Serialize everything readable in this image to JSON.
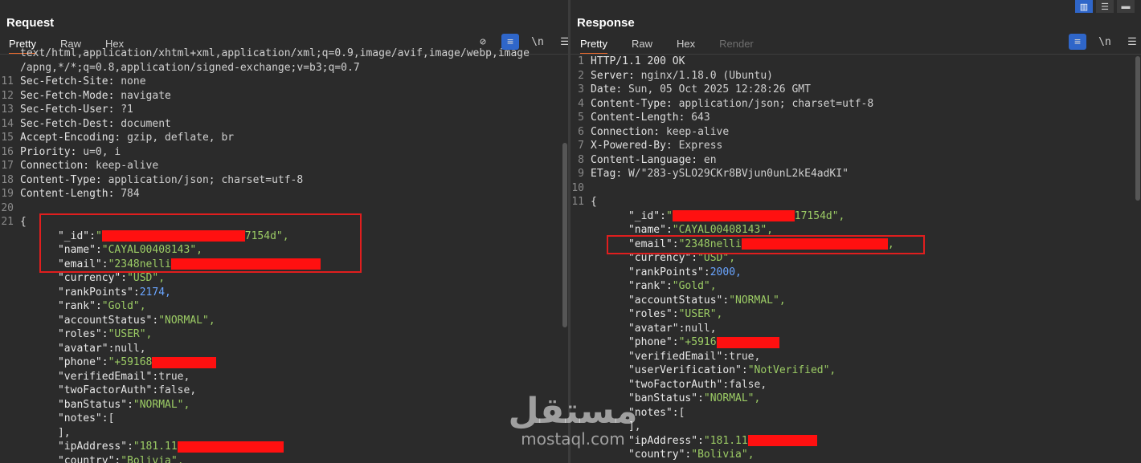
{
  "request": {
    "title": "Request",
    "tabs": [
      "Pretty",
      "Raw",
      "Hex"
    ],
    "tools": {
      "hide": "⊘",
      "wrap": "≡",
      "newline": "\\n",
      "menu": "☰"
    },
    "overflow_line": "text/html,application/xhtml+xml,application/xml;q=0.9,image/avif,image/webp,image",
    "line9_text": "/apng,*/*;q=0.8,application/signed-exchange;v=b3;q=0.7",
    "headers": [
      {
        "num": "11",
        "key": "Sec-Fetch-Site",
        "val": "none"
      },
      {
        "num": "12",
        "key": "Sec-Fetch-Mode",
        "val": "navigate"
      },
      {
        "num": "13",
        "key": "Sec-Fetch-User",
        "val": "?1"
      },
      {
        "num": "14",
        "key": "Sec-Fetch-Dest",
        "val": "document"
      },
      {
        "num": "15",
        "key": "Accept-Encoding",
        "val": "gzip, deflate, br"
      },
      {
        "num": "16",
        "key": "Priority",
        "val": "u=0, i"
      },
      {
        "num": "17",
        "key": "Connection",
        "val": "keep-alive"
      },
      {
        "num": "18",
        "key": "Content-Type",
        "val": "application/json; charset=utf-8"
      },
      {
        "num": "19",
        "key": "Content-Length",
        "val": "784"
      }
    ],
    "blank_num": "20",
    "brace_num": "21",
    "json_lines": [
      {
        "key": "\"_id\"",
        "val": "\"",
        "tail": "7154d\",",
        "type": "s",
        "redact": 178
      },
      {
        "key": "\"name\"",
        "val": "\"CAYAL00408143\",",
        "type": "s"
      },
      {
        "key": "\"email\"",
        "val": "\"2348nelli",
        "tail": "",
        "type": "s",
        "redact": 186
      },
      {
        "key": "\"currency\"",
        "val": "\"USD\",",
        "type": "s"
      },
      {
        "key": "\"rankPoints\"",
        "val": "2174,",
        "type": "n"
      },
      {
        "key": "\"rank\"",
        "val": "\"Gold\",",
        "type": "s"
      },
      {
        "key": "\"accountStatus\"",
        "val": "\"NORMAL\",",
        "type": "s"
      },
      {
        "key": "\"roles\"",
        "val": "\"USER\",",
        "type": "s"
      },
      {
        "key": "\"avatar\"",
        "val": "null,",
        "type": "b"
      },
      {
        "key": "\"phone\"",
        "val": "\"+59168",
        "tail": "",
        "type": "s",
        "redact": 80
      },
      {
        "key": "\"verifiedEmail\"",
        "val": "true,",
        "type": "b"
      },
      {
        "key": "\"twoFactorAuth\"",
        "val": "false,",
        "type": "b"
      },
      {
        "key": "\"banStatus\"",
        "val": "\"NORMAL\",",
        "type": "s"
      },
      {
        "key": "\"notes\"",
        "val": "[",
        "type": "b"
      },
      {
        "key": "",
        "val": "],",
        "type": "b"
      },
      {
        "key": "\"ipAddress\"",
        "val": "\"181.11",
        "tail": "",
        "type": "s",
        "redact": 132
      },
      {
        "key": "\"country\"",
        "val": "\"Bolivia\",",
        "type": "s"
      }
    ]
  },
  "response": {
    "title": "Response",
    "tabs": [
      "Pretty",
      "Raw",
      "Hex",
      "Render"
    ],
    "tools": {
      "wrap": "≡",
      "newline": "\\n",
      "menu": "☰"
    },
    "view_buttons": [
      "▥",
      "☰",
      "▬"
    ],
    "headers": [
      {
        "num": "1",
        "text": "HTTP/1.1 200 OK"
      },
      {
        "num": "2",
        "key": "Server",
        "val": "nginx/1.18.0 (Ubuntu)"
      },
      {
        "num": "3",
        "key": "Date",
        "val": "Sun, 05 Oct 2025 12:28:26 GMT"
      },
      {
        "num": "4",
        "key": "Content-Type",
        "val": "application/json; charset=utf-8"
      },
      {
        "num": "5",
        "key": "Content-Length",
        "val": "643"
      },
      {
        "num": "6",
        "key": "Connection",
        "val": "keep-alive"
      },
      {
        "num": "7",
        "key": "X-Powered-By",
        "val": "Express"
      },
      {
        "num": "8",
        "key": "Content-Language",
        "val": "en"
      },
      {
        "num": "9",
        "key": "ETag",
        "val": "W/\"283-ySLO29CKr8BVjun0unL2kE4adKI\""
      }
    ],
    "blank_num": "10",
    "brace_num": "11",
    "json_lines": [
      {
        "key": "\"_id\"",
        "val": "\"",
        "tail": "17154d\",",
        "type": "s",
        "redact": 152
      },
      {
        "key": "\"name\"",
        "val": "\"CAYAL00408143\",",
        "type": "s"
      },
      {
        "key": "\"email\"",
        "val": "\"2348nelli",
        "tail": ",",
        "type": "s",
        "redact": 182
      },
      {
        "key": "\"currency\"",
        "val": "\"USD\",",
        "type": "s"
      },
      {
        "key": "\"rankPoints\"",
        "val": "2000,",
        "type": "n"
      },
      {
        "key": "\"rank\"",
        "val": "\"Gold\",",
        "type": "s"
      },
      {
        "key": "\"accountStatus\"",
        "val": "\"NORMAL\",",
        "type": "s"
      },
      {
        "key": "\"roles\"",
        "val": "\"USER\",",
        "type": "s"
      },
      {
        "key": "\"avatar\"",
        "val": "null,",
        "type": "b"
      },
      {
        "key": "\"phone\"",
        "val": "\"+5916",
        "tail": "",
        "type": "s",
        "redact": 78
      },
      {
        "key": "\"verifiedEmail\"",
        "val": "true,",
        "type": "b"
      },
      {
        "key": "\"userVerification\"",
        "val": "\"NotVerified\",",
        "type": "s"
      },
      {
        "key": "\"twoFactorAuth\"",
        "val": "false,",
        "type": "b"
      },
      {
        "key": "\"banStatus\"",
        "val": "\"NORMAL\",",
        "type": "s"
      },
      {
        "key": "\"notes\"",
        "val": "[",
        "type": "b"
      },
      {
        "key": "",
        "val": "],",
        "type": "b"
      },
      {
        "key": "\"ipAddress\"",
        "val": "\"181.11",
        "tail": "",
        "type": "s",
        "redact": 86
      },
      {
        "key": "\"country\"",
        "val": "\"Bolivia\",",
        "type": "s"
      }
    ]
  },
  "watermark": {
    "arabic": "مستقل",
    "latin": "mostaql.com"
  },
  "colors": {
    "accent_tab": "#e8692d",
    "tool_on": "#2f66c9",
    "string": "#9ccc65",
    "number": "#6aa5ff",
    "redact": "#ff1010",
    "box": "#e01e1e"
  }
}
